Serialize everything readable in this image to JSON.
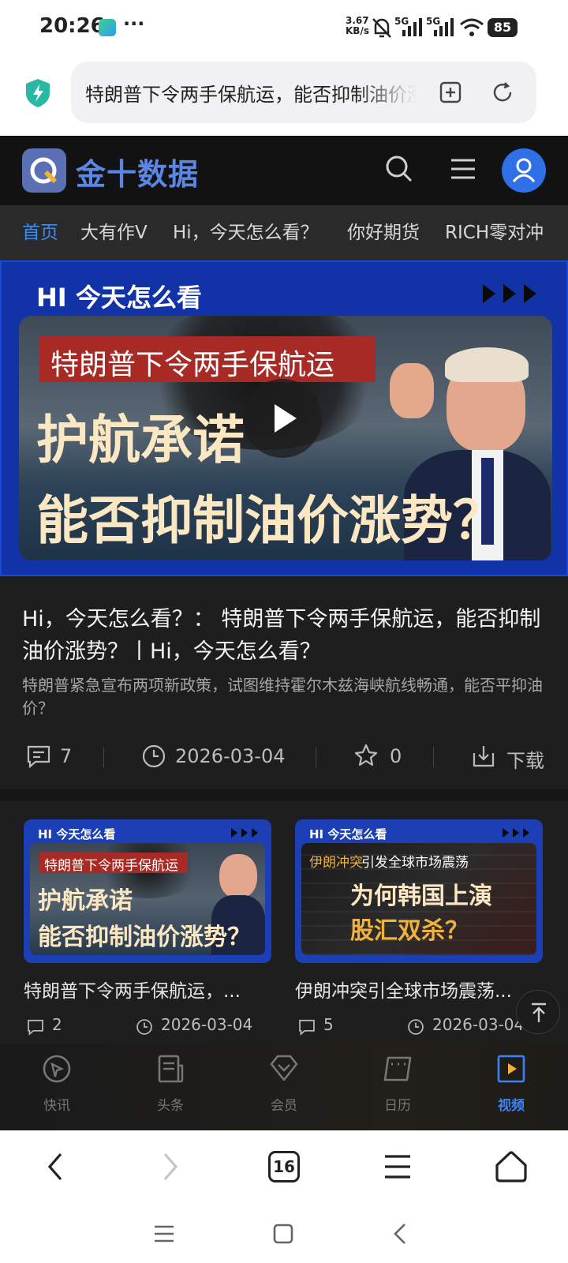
{
  "status": {
    "time": "20:26",
    "dots": "···",
    "speed_top": "3.67",
    "speed_bottom": "KB/s",
    "net1": "5G",
    "net2": "5G",
    "battery": "85"
  },
  "address": {
    "text": "特朗普下令两手保航运，能否抑制油价涨势？"
  },
  "site": {
    "logo_text": "金十数据",
    "tabs": [
      {
        "label": "首页",
        "active": true
      },
      {
        "label": "大有作V"
      },
      {
        "label": "Hi，今天怎么看？"
      },
      {
        "label": "你好期货"
      },
      {
        "label": "RICH零对冲"
      }
    ],
    "hero": {
      "tag": "HI 今天怎么看",
      "red_title": "特朗普下令两手保航运",
      "big1": "护航承诺",
      "big2": "能否抑制油价涨势？"
    },
    "article": {
      "title": "Hi，今天怎么看？：  特朗普下令两手保航运，能否抑制油价涨势？丨Hi，今天怎么看？",
      "desc": "特朗普紧急宣布两项新政策，试图维持霍尔木兹海峡航线畅通，能否平抑油价？",
      "comments": "7",
      "date": "2026-03-04",
      "stars": "0",
      "download": "下载"
    },
    "cards": [
      {
        "tag": "HI 今天怎么看",
        "red": "特朗普下令两手保航运",
        "big1": "护航承诺",
        "big2": "能否抑制油价涨势？",
        "title": "特朗普下令两手保航运，...",
        "comments": "2",
        "date": "2026-03-04"
      },
      {
        "tag": "HI 今天怎么看",
        "top_orange": "伊朗冲突",
        "top_white": "引发全球市场震荡",
        "big1": "为何韩国上演",
        "big2": "股汇双杀？",
        "title": "伊朗冲突引全球市场震荡...",
        "comments": "5",
        "date": "2026-03-04"
      }
    ],
    "bottom_nav": [
      {
        "label": "快讯",
        "icon": "flash-news-icon"
      },
      {
        "label": "头条",
        "icon": "headline-icon"
      },
      {
        "label": "会员",
        "icon": "vip-icon"
      },
      {
        "label": "日历",
        "icon": "calendar-icon"
      },
      {
        "label": "视频",
        "icon": "video-icon",
        "active": true
      }
    ]
  },
  "browser": {
    "tab_count": "16"
  },
  "colors": {
    "accent": "#4a8df6",
    "dark_bg": "#1e1e1f",
    "hero_blue": "#1233a8",
    "active_blue": "#3b82f6"
  }
}
